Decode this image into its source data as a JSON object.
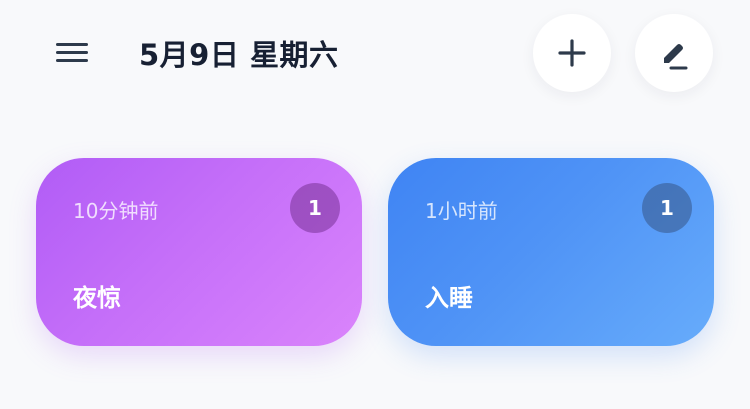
{
  "header": {
    "menu_icon": "hamburger-menu-icon",
    "date_title": "5月9日 星期六",
    "add_icon": "plus-icon",
    "edit_icon": "pencil-edit-icon",
    "icon_color": "#2d3a4b"
  },
  "cards": [
    {
      "time_ago": "10分钟前",
      "name": "夜惊",
      "count": "1",
      "color_start": "#b15cf6",
      "color_end": "#da84fb"
    },
    {
      "time_ago": "1小时前",
      "name": "入睡",
      "count": "1",
      "color_start": "#3f84f3",
      "color_end": "#67acfb"
    }
  ]
}
